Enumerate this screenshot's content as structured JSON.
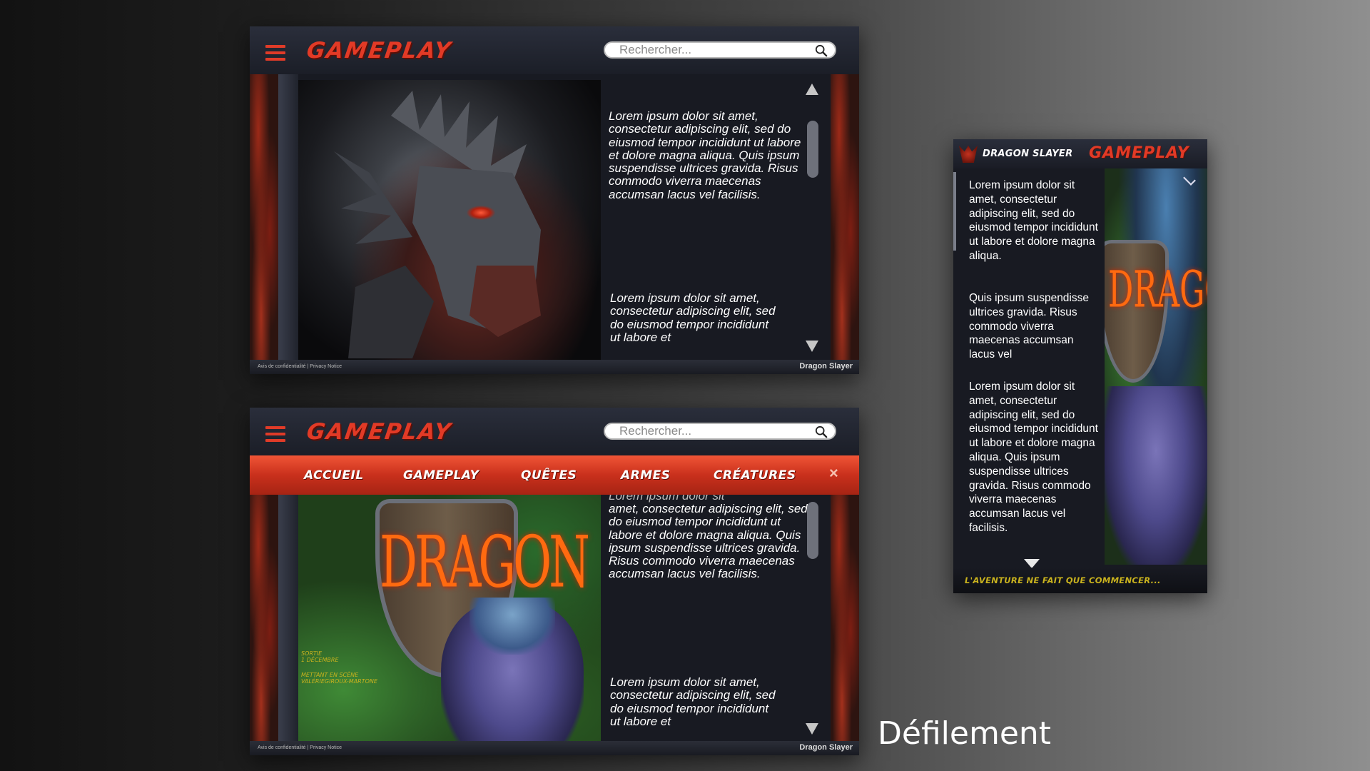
{
  "colors": {
    "accent": "#e23a26",
    "nav_bar": "#c9301c",
    "header": "#1f222c",
    "credits_gold": "#c9b21e"
  },
  "icons": {
    "menu": "hamburger-icon",
    "search": "search-icon",
    "close": "close-icon",
    "scroll_up": "triangle-up-icon",
    "scroll_down": "triangle-down-icon",
    "chevron": "chevron-down-icon"
  },
  "desktop_top": {
    "logo": "GAMEPLAY",
    "search": {
      "placeholder": "Rechercher..."
    },
    "paragraph_1": "Lorem ipsum dolor sit amet, consectetur adipiscing elit, sed do eiusmod tempor incididunt ut labore et dolore magna aliqua. Quis ipsum suspendisse ultrices gravida. Risus commodo viverra maecenas accumsan lacus vel facilisis.",
    "paragraph_2": "Lorem ipsum dolor sit amet, consectetur adipiscing elit, sed do eiusmod tempor incididunt ut labore et",
    "footer_links": "Avis de confidentialité | Privacy Notice",
    "footer_brand": "Dragon Slayer"
  },
  "desktop_bottom": {
    "logo": "GAMEPLAY",
    "search": {
      "placeholder": "Rechercher..."
    },
    "nav": [
      "ACCUEIL",
      "GAMEPLAY",
      "QUÊTES",
      "ARMES",
      "CRÉATURES"
    ],
    "close_label": "×",
    "poster_title": "DRAGON",
    "credit_line_1": "Sortie",
    "credit_line_2": "1 décembre",
    "credit_line_3": "Mettant en scène",
    "credit_line_4": "ValérieGiroux-Martone",
    "paragraph_0": "Lorem ipsum dolor sit",
    "paragraph_1": "amet, consectetur adipiscing elit, sed do eiusmod tempor incididunt ut labore et dolore magna aliqua. Quis ipsum suspendisse ultrices gravida. Risus commodo viverra maecenas accumsan lacus vel facilisis.",
    "paragraph_2": "Lorem ipsum dolor sit amet, consectetur adipiscing elit, sed do eiusmod tempor incididunt ut labore et",
    "footer_links": "Avis de confidentialité | Privacy Notice",
    "footer_brand": "Dragon Slayer"
  },
  "mobile": {
    "subtitle": "DRAGON SLAYER",
    "logo": "GAMEPLAY",
    "poster_title": "DRAGON",
    "paragraph_1": "Lorem ipsum dolor sit amet, consectetur adipiscing elit, sed do eiusmod tempor incididunt ut labore et dolore magna aliqua.",
    "paragraph_2": "Quis ipsum suspendisse ultrices gravida. Risus commodo viverra maecenas accumsan lacus vel",
    "paragraph_3": "Lorem ipsum dolor sit amet, consectetur adipiscing elit, sed do eiusmod tempor incididunt ut labore et dolore magna aliqua. Quis ipsum suspendisse ultrices gravida. Risus commodo viverra maecenas accumsan lacus vel facilisis.",
    "tagline": "L'AVENTURE NE FAIT QUE COMMENCER..."
  },
  "caption": "Défilement"
}
